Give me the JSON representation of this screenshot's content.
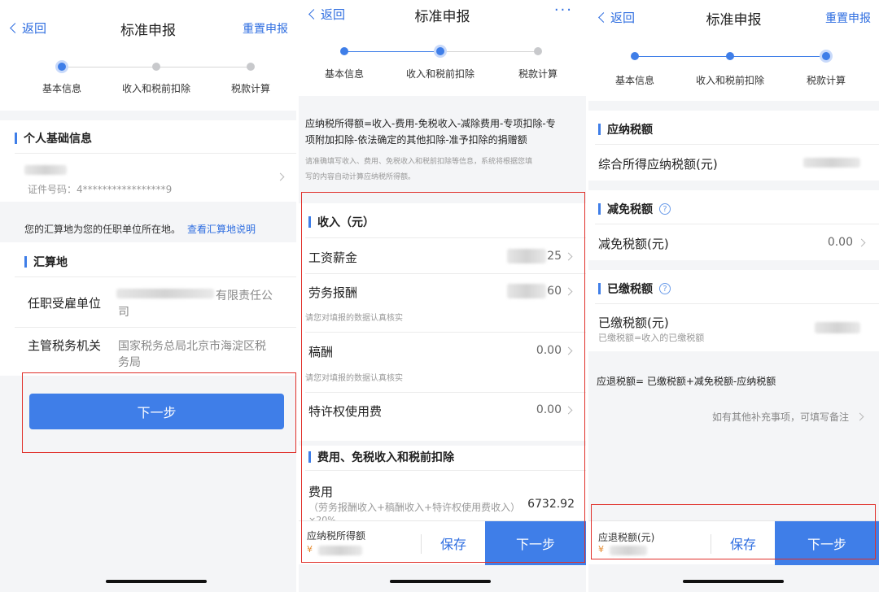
{
  "screen1": {
    "nav": {
      "back": "返回",
      "title": "标准申报",
      "right": "重置申报"
    },
    "steps": [
      "基本信息",
      "收入和税前扣除",
      "税款计算"
    ],
    "personal_section": "个人基础信息",
    "id_label": "证件号码：4*****************9",
    "notice_text": "您的汇算地为您的任职单位所在地。",
    "notice_link": "查看汇算地说明",
    "settle_section": "汇算地",
    "employer_label": "任职受雇单位",
    "employer_value_end": "有限责任公",
    "employer_value_line2": "司",
    "tax_office_label": "主管税务机关",
    "tax_office_value_1": "国家税务总局北京市海淀区税",
    "tax_office_value_2": "务局",
    "next_button": "下一步"
  },
  "screen2": {
    "nav": {
      "back": "返回",
      "title": "标准申报",
      "dots": "···"
    },
    "steps": [
      "基本信息",
      "收入和税前扣除",
      "税款计算"
    ],
    "formula_1": "应纳税所得额=收入-费用-免税收入-减除费用-专项扣除-专",
    "formula_2": "项附加扣除-依法确定的其他扣除-准予扣除的捐赠额",
    "hint_1": "请准确填写收入、费用、免税收入和税前扣除等信息，系统将根据您填",
    "hint_2": "写的内容自动计算应纳税所得额。",
    "income_section": "收入（元）",
    "rows": [
      {
        "label": "工资薪金",
        "value": "25"
      },
      {
        "label": "劳务报酬",
        "value": "60",
        "sub": "请您对填报的数据认真核实"
      },
      {
        "label": "稿酬",
        "value": "0.00",
        "sub": "请您对填报的数据认真核实"
      },
      {
        "label": "特许权使用费",
        "value": "0.00"
      }
    ],
    "expense_section": "费用、免税收入和税前扣除",
    "expense_label": "费用",
    "expense_formula": "（劳务报酬收入+稿酬收入+特许权使用费收入）",
    "expense_value": "6732.92",
    "expense_formula_2": "×20%",
    "footer_label": "应纳税所得额",
    "footer_currency": "¥",
    "save_button": "保存",
    "next_button": "下一步"
  },
  "screen3": {
    "nav": {
      "back": "返回",
      "title": "标准申报",
      "right": "重置申报"
    },
    "steps": [
      "基本信息",
      "收入和税前扣除",
      "税款计算"
    ],
    "payable_section": "应纳税额",
    "payable_label": "综合所得应纳税额(元)",
    "reduce_section": "减免税额",
    "reduce_label": "减免税额(元)",
    "reduce_value": "0.00",
    "paid_section": "已缴税额",
    "paid_label": "已缴税额(元)",
    "paid_sub": "已缴税额=收入的已缴税额",
    "refund_formula": "应退税额= 已缴税额+减免税额-应纳税额",
    "remark_link": "如有其他补充事项，可填写备注",
    "footer_label": "应退税额(元)",
    "footer_currency": "¥",
    "save_button": "保存",
    "next_button": "下一步"
  },
  "colors": {
    "accent": "#3f7ee8",
    "highlight_box": "#e0302a",
    "link": "#2f6ee0"
  }
}
